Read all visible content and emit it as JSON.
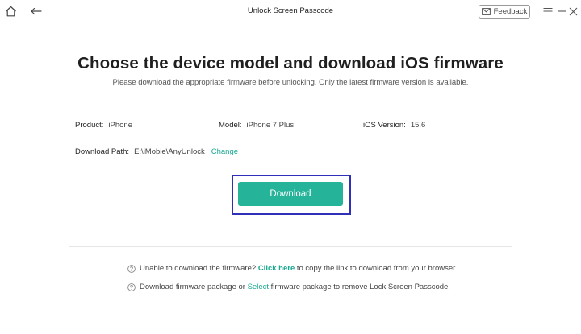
{
  "window": {
    "title": "Unlock Screen Passcode",
    "feedback_label": "Feedback",
    "icons": [
      "home-icon",
      "back-arrow-icon",
      "feedback-mail-icon",
      "hamburger-menu-icon",
      "minimize-icon",
      "close-icon"
    ]
  },
  "header": {
    "title": "Choose the device model and download iOS firmware",
    "subtitle": "Please download the appropriate firmware before unlocking. Only the latest firmware version is available."
  },
  "device": {
    "product_label": "Product:",
    "product_value": "iPhone",
    "model_label": "Model:",
    "model_value": "iPhone 7 Plus",
    "ios_label": "iOS Version:",
    "ios_value": "15.6",
    "path_label": "Download Path:",
    "path_value": "E:\\iMobie\\AnyUnlock",
    "change_label": "Change"
  },
  "actions": {
    "download_label": "Download"
  },
  "help": {
    "line1_pre": "Unable to download the firmware? ",
    "line1_link": "Click here",
    "line1_post": " to copy the link to download from your browser.",
    "line2_pre": "Download firmware package or ",
    "line2_link": "Select",
    "line2_post": " firmware package to remove Lock Screen Passcode."
  },
  "colors": {
    "accent": "#25b39a",
    "link": "#1aa892",
    "focus_frame": "#2f2fb8"
  }
}
